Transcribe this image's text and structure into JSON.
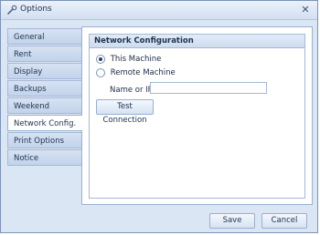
{
  "window": {
    "title": "Options"
  },
  "sidebar": {
    "tabs": [
      {
        "label": "General"
      },
      {
        "label": "Rent"
      },
      {
        "label": "Display"
      },
      {
        "label": "Backups"
      },
      {
        "label": "Weekend"
      },
      {
        "label": "Network Config."
      },
      {
        "label": "Print Options"
      },
      {
        "label": "Notice"
      }
    ],
    "active_index": 5
  },
  "network": {
    "header": "Network Configuration",
    "this_machine_label": "This Machine",
    "remote_machine_label": "Remote Machine",
    "selected": "This Machine",
    "name_or_ip_label": "Name or IP:",
    "name_or_ip_value": "",
    "test_connection_label": "Test Connection"
  },
  "footer": {
    "save_label": "Save",
    "cancel_label": "Cancel"
  },
  "icons": {
    "app": "wrench-icon",
    "close": "close-icon"
  }
}
